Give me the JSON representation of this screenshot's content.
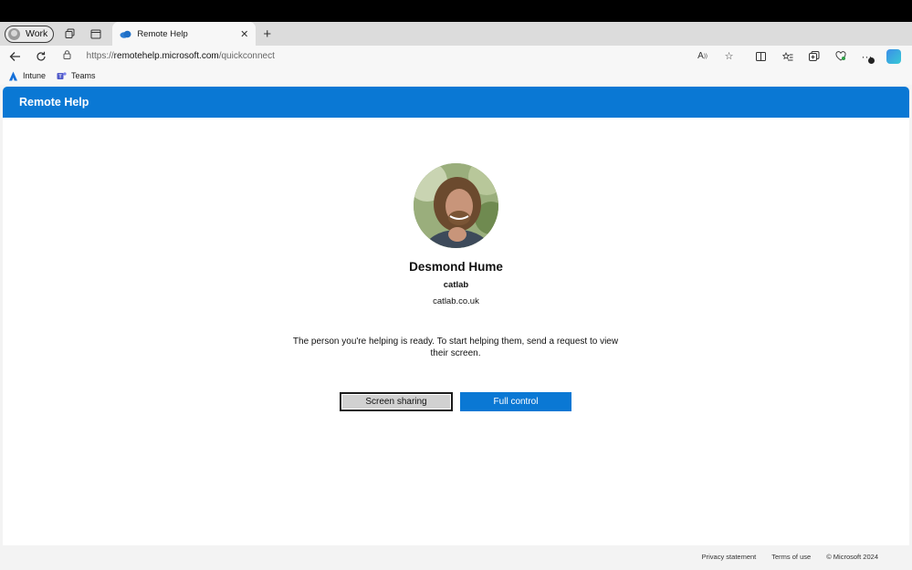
{
  "browser": {
    "profile_label": "Work",
    "tab_title": "Remote Help",
    "url_prefix": "https://",
    "url_host": "remotehelp.microsoft.com",
    "url_path": "/quickconnect",
    "favorites": [
      {
        "label": "Intune",
        "icon": "intune-icon"
      },
      {
        "label": "Teams",
        "icon": "teams-icon"
      }
    ]
  },
  "app": {
    "header_title": "Remote Help"
  },
  "user": {
    "name": "Desmond Hume",
    "org": "catlab",
    "domain": "catlab.co.uk"
  },
  "main": {
    "message": "The person you're helping is ready. To start helping them, send a request to view their screen.",
    "screen_sharing_label": "Screen sharing",
    "full_control_label": "Full control"
  },
  "footer": {
    "privacy": "Privacy statement",
    "terms": "Terms of use",
    "copyright": "© Microsoft 2024"
  },
  "colors": {
    "accent": "#0a78d4"
  }
}
